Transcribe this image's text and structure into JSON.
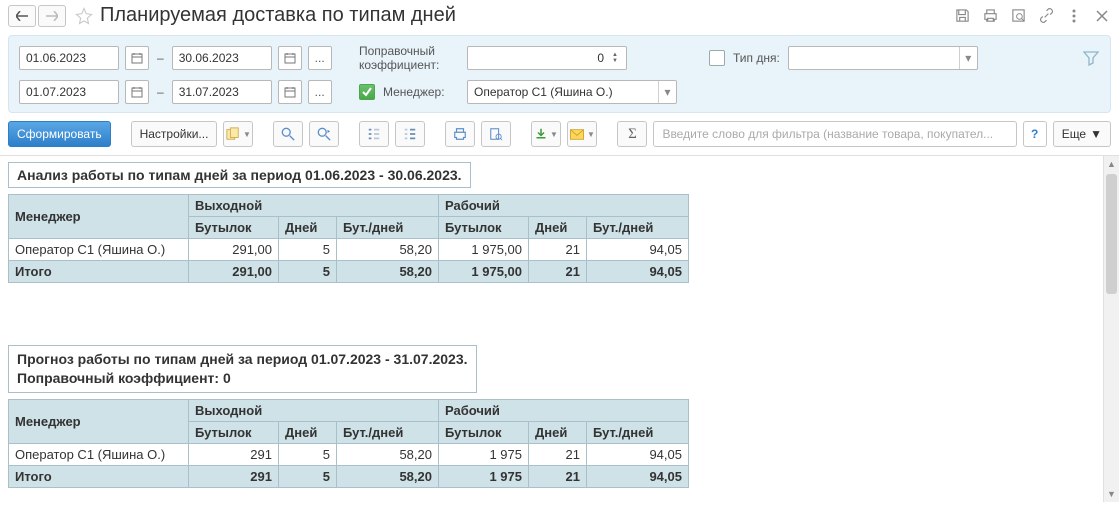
{
  "title": "Планируемая доставка по типам дней",
  "dates": {
    "period1_from": "01.06.2023",
    "period1_to": "30.06.2023",
    "period2_from": "01.07.2023",
    "period2_to": "31.07.2023",
    "dash": "–",
    "dots": "..."
  },
  "filters": {
    "coeff_label": "Поправочный коэффициент:",
    "coeff_value": "0",
    "manager_label": "Менеджер:",
    "manager_value": "Оператор С1 (Яшина О.)",
    "daytype_label": "Тип дня:",
    "daytype_value": ""
  },
  "toolbar": {
    "run": "Сформировать",
    "settings": "Настройки...",
    "search_placeholder": "Введите слово для фильтра (название товара, покупател...",
    "help": "?",
    "more": "Еще"
  },
  "report1": {
    "title": "Анализ работы  по типам дней  за период 01.06.2023 - 30.06.2023.",
    "headers": {
      "manager": "Менеджер",
      "group_off": "Выходной",
      "group_work": "Рабочий",
      "bottles": "Бутылок",
      "days": "Дней",
      "bpd": "Бут./дней"
    },
    "rows": [
      {
        "manager": "Оператор С1 (Яшина О.)",
        "off_b": "291,00",
        "off_d": "5",
        "off_bpd": "58,20",
        "work_b": "1 975,00",
        "work_d": "21",
        "work_bpd": "94,05"
      }
    ],
    "total_label": "Итого",
    "total": {
      "off_b": "291,00",
      "off_d": "5",
      "off_bpd": "58,20",
      "work_b": "1 975,00",
      "work_d": "21",
      "work_bpd": "94,05"
    }
  },
  "report2": {
    "title_line1": "Прогноз работы по типам дней за период 01.07.2023 - 31.07.2023.",
    "title_line2": "Поправочный коэффициент: 0",
    "headers": {
      "manager": "Менеджер",
      "group_off": "Выходной",
      "group_work": "Рабочий",
      "bottles": "Бутылок",
      "days": "Дней",
      "bpd": "Бут./дней"
    },
    "rows": [
      {
        "manager": "Оператор С1 (Яшина О.)",
        "off_b": "291",
        "off_d": "5",
        "off_bpd": "58,20",
        "work_b": "1 975",
        "work_d": "21",
        "work_bpd": "94,05"
      }
    ],
    "total_label": "Итого",
    "total": {
      "off_b": "291",
      "off_d": "5",
      "off_bpd": "58,20",
      "work_b": "1 975",
      "work_d": "21",
      "work_bpd": "94,05"
    }
  }
}
